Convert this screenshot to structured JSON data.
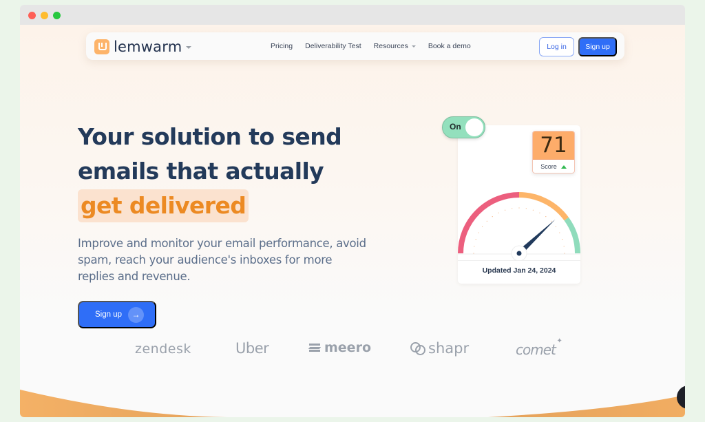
{
  "window": {
    "controls": [
      "close",
      "minimize",
      "maximize"
    ]
  },
  "nav": {
    "logo_text": "lemwarm",
    "links": [
      {
        "label": "Pricing",
        "has_dropdown": false
      },
      {
        "label": "Deliverability Test",
        "has_dropdown": false
      },
      {
        "label": "Resources",
        "has_dropdown": true
      },
      {
        "label": "Book a demo",
        "has_dropdown": false
      }
    ],
    "login_label": "Log in",
    "signup_label": "Sign up"
  },
  "hero": {
    "headline_line1": "Your solution to send",
    "headline_line2": "emails that actually",
    "headline_highlight": "get delivered",
    "subtext": "Improve and monitor your email performance, avoid spam, reach your audience's inboxes for more replies and revenue.",
    "cta_label": "Sign up",
    "cta_icon": "arrow-right-icon"
  },
  "widget": {
    "toggle_label": "On",
    "toggle_state": true,
    "score": "71",
    "score_label": "Score",
    "score_trend": "up",
    "gauge_value_fraction": 0.76,
    "updated_text": "Updated Jan 24, 2024",
    "colors": {
      "low": "#ec5f7e",
      "mid": "#fdb569",
      "high": "#8fdcbc",
      "needle": "#213a5c"
    }
  },
  "customers": [
    "zendesk",
    "Uber",
    "meero",
    "shapr",
    "comet"
  ],
  "colors": {
    "primary": "#2f6ef7",
    "accent": "#ec8a23",
    "headline": "#233a5a"
  }
}
